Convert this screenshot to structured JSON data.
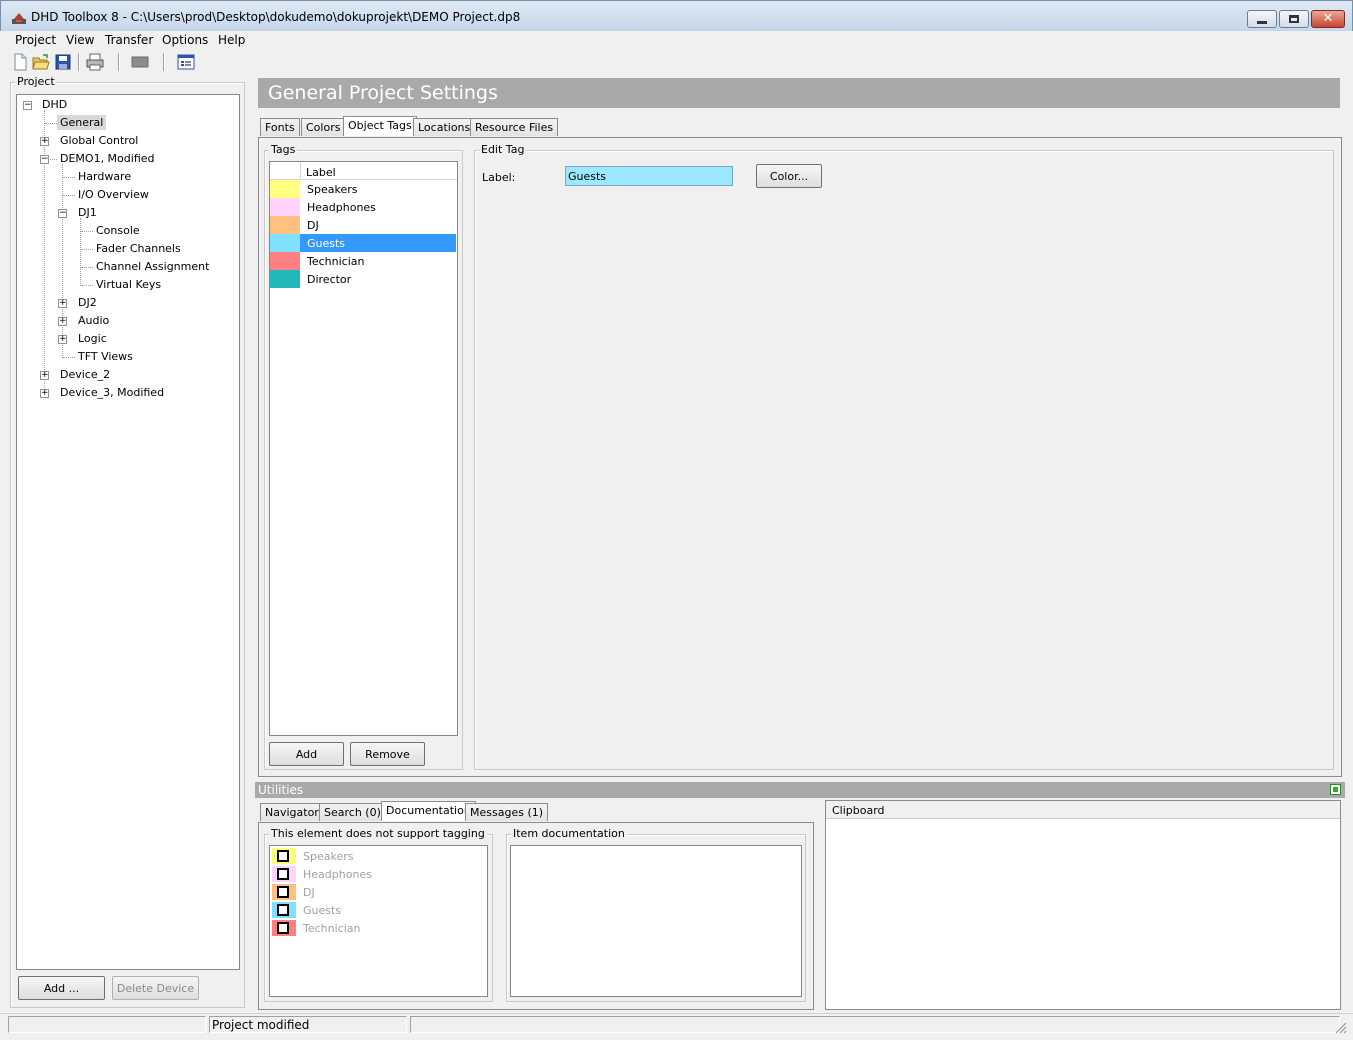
{
  "window": {
    "title": "DHD Toolbox 8 - C:\\Users\\prod\\Desktop\\dokudemo\\dokuprojekt\\DEMO Project.dp8"
  },
  "menu": [
    "Project",
    "View",
    "Transfer",
    "Options",
    "Help"
  ],
  "toolbar": {
    "icons": [
      "new-file-icon",
      "open-folder-icon",
      "save-icon",
      "print-icon",
      "device-icon",
      "properties-icon"
    ]
  },
  "project_panel": {
    "legend": "Project",
    "tree": {
      "root": "DHD",
      "general": "General",
      "global_control": "Global Control",
      "demo1": "DEMO1, Modified",
      "hardware": "Hardware",
      "io_overview": "I/O Overview",
      "dj1": "DJ1",
      "console": "Console",
      "fader_channels": "Fader Channels",
      "channel_assignment": "Channel Assignment",
      "virtual_keys": "Virtual Keys",
      "dj2": "DJ2",
      "audio": "Audio",
      "logic": "Logic",
      "tft_views": "TFT Views",
      "device2": "Device_2",
      "device3": "Device_3, Modified"
    },
    "add_button": "Add ...",
    "delete_button": "Delete Device"
  },
  "settings": {
    "header": "General Project Settings",
    "tabs": [
      "Fonts",
      "Colors",
      "Object Tags",
      "Locations",
      "Resource Files"
    ],
    "active_tab": "Object Tags",
    "tags_legend": "Tags",
    "tags_column": "Label",
    "tags": [
      {
        "label": "Speakers",
        "color": "#ffff80"
      },
      {
        "label": "Headphones",
        "color": "#ffd5ff"
      },
      {
        "label": "DJ",
        "color": "#ffc080"
      },
      {
        "label": "Guests",
        "color": "#80e0ff"
      },
      {
        "label": "Technician",
        "color": "#ff8080"
      },
      {
        "label": "Director",
        "color": "#20b8b8"
      }
    ],
    "selected_tag": "Guests",
    "add_button": "Add",
    "remove_button": "Remove",
    "edit_legend": "Edit Tag",
    "label_caption": "Label:",
    "label_value": "Guests",
    "color_button": "Color..."
  },
  "utilities": {
    "header": "Utilities",
    "tabs": [
      "Navigator",
      "Search (0)",
      "Documentation",
      "Messages (1)"
    ],
    "active_tab": "Documentation",
    "tagging_legend": "This element does not support tagging",
    "doc_tags": [
      {
        "label": "Speakers",
        "color": "#ffff80"
      },
      {
        "label": "Headphones",
        "color": "#ffd5ff"
      },
      {
        "label": "DJ",
        "color": "#ffc080"
      },
      {
        "label": "Guests",
        "color": "#80e0ff"
      },
      {
        "label": "Technician",
        "color": "#ff8080"
      }
    ],
    "item_doc_legend": "Item documentation",
    "clipboard": "Clipboard"
  },
  "statusbar": {
    "left": "",
    "message": "Project modified"
  },
  "colors": {
    "header_bg": "#a9a9a9",
    "selection": "#3399ff",
    "label_field": "#9be8ff"
  }
}
